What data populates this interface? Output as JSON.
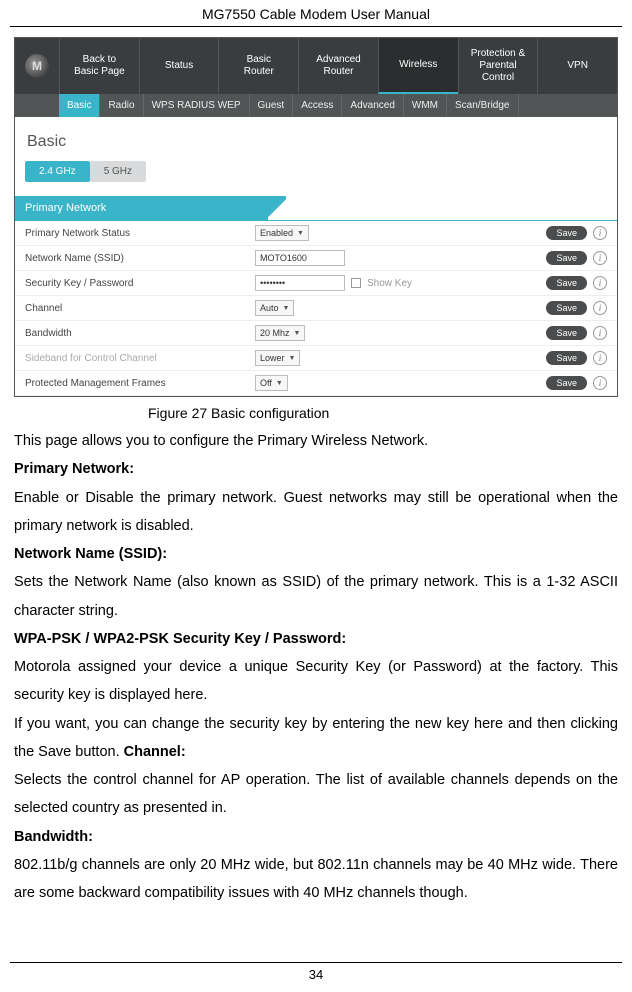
{
  "header": "MG7550 Cable Modem User Manual",
  "page_number": "34",
  "figure_caption": "Figure 27 Basic configuration",
  "screenshot": {
    "logo_letter": "M",
    "top_nav": [
      {
        "line1": "Back to",
        "line2": "Basic Page"
      },
      {
        "line1": "Status",
        "line2": ""
      },
      {
        "line1": "Basic",
        "line2": "Router"
      },
      {
        "line1": "Advanced",
        "line2": "Router"
      },
      {
        "line1": "Wireless",
        "line2": ""
      },
      {
        "line1": "Protection &",
        "line2": "Parental Control"
      },
      {
        "line1": "VPN",
        "line2": ""
      }
    ],
    "top_nav_active_index": 4,
    "sub_nav": [
      "Basic",
      "Radio",
      "WPS RADIUS WEP",
      "Guest",
      "Access",
      "Advanced",
      "WMM",
      "Scan/Bridge"
    ],
    "sub_nav_active_index": 0,
    "page_title": "Basic",
    "freq_tabs": [
      "2.4 GHz",
      "5 GHz"
    ],
    "freq_active_index": 0,
    "panel_title": "Primary Network",
    "rows": [
      {
        "label": "Primary Network Status",
        "type": "select",
        "value": "Enabled",
        "muted": false
      },
      {
        "label": "Network Name (SSID)",
        "type": "input",
        "value": "MOTO1600",
        "muted": false
      },
      {
        "label": "Security Key / Password",
        "type": "password",
        "value": "••••••••",
        "showkey": true,
        "muted": false
      },
      {
        "label": "Channel",
        "type": "select",
        "value": "Auto",
        "muted": false
      },
      {
        "label": "Bandwidth",
        "type": "select",
        "value": "20 Mhz",
        "muted": false
      },
      {
        "label": "Sideband for Control Channel",
        "type": "select",
        "value": "Lower",
        "muted": true
      },
      {
        "label": "Protected Management Frames",
        "type": "select",
        "value": "Off",
        "muted": false
      }
    ],
    "showkey_label": "Show Key",
    "save_label": "Save"
  },
  "body": {
    "intro": "This page allows you to configure the Primary Wireless Network.",
    "h1": "Primary Network:",
    "p1": "Enable or Disable the primary network. Guest networks may still be operational when the primary network is disabled.",
    "h2": "Network Name (SSID):",
    "p2": "Sets the Network Name (also known as SSID) of the primary network. This is a 1-32 ASCII character string.",
    "h3": "WPA-PSK / WPA2-PSK Security Key / Password:",
    "p3a": "Motorola assigned your device a unique Security Key (or Password) at the factory. This security key is displayed here.",
    "p3b_pre": "If you want, you can change the security key by entering the new key here and then clicking the Save button. ",
    "h4_inline": "Channel:",
    "p4": "Selects the control channel for AP operation. The list of available channels depends on the selected country as presented in.",
    "h5": "Bandwidth:",
    "p5": "802.11b/g channels are only 20 MHz wide, but 802.11n channels may be 40 MHz wide. There are some backward compatibility issues with 40 MHz channels though."
  }
}
